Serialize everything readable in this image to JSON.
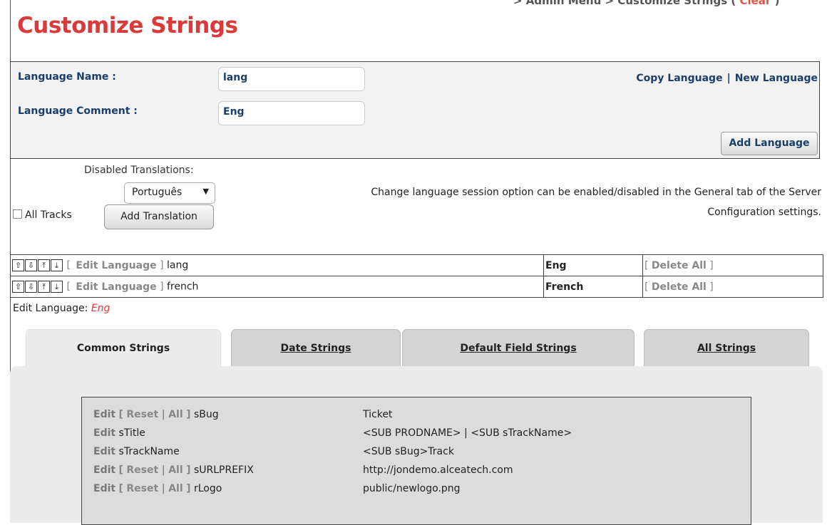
{
  "breadcrumb": {
    "admin": "> Admin Menu",
    "page": "> Customize Strings",
    "clear_open": "(",
    "clear": "Clear",
    "clear_close": ")"
  },
  "title": "Customize Strings",
  "lang_form": {
    "name_label": "Language Name :",
    "name_value": "lang",
    "comment_label": "Language Comment :",
    "comment_value": "Eng",
    "copy_language": "Copy Language",
    "link_sep": "|",
    "new_language": "New Language",
    "add_language_button": "Add Language"
  },
  "translations": {
    "disabled_label": "Disabled Translations:",
    "selected_language": "Português",
    "all_tracks_label": "All Tracks",
    "all_tracks_checked": false,
    "add_translation_button": "Add Translation",
    "notice_line1": "Change language session option can be enabled/disabled in the General tab of the Server",
    "notice_line2": "Configuration settings."
  },
  "languages": [
    {
      "edit": "Edit Language",
      "name": "lang",
      "comment": "Eng",
      "delete": "Delete All"
    },
    {
      "edit": "Edit Language",
      "name": "french",
      "comment": "French",
      "delete": "Delete All"
    }
  ],
  "edit_language": {
    "label": "Edit Language:",
    "value": "Eng"
  },
  "tabs": [
    {
      "label": "Common Strings",
      "active": true
    },
    {
      "label": "Date Strings",
      "active": false
    },
    {
      "label": "Default Field Strings",
      "active": false
    },
    {
      "label": "All Strings",
      "active": false
    }
  ],
  "strings": [
    {
      "edit": "Edit",
      "reset": "Reset",
      "all": "All",
      "has_reset": true,
      "key": "sBug",
      "value": "Ticket"
    },
    {
      "edit": "Edit",
      "reset": "",
      "all": "",
      "has_reset": false,
      "key": "sTitle",
      "value": "<SUB PRODNAME> | <SUB sTrackName>"
    },
    {
      "edit": "Edit",
      "reset": "",
      "all": "",
      "has_reset": false,
      "key": "sTrackName",
      "value": "<SUB sBug>Track"
    },
    {
      "edit": "Edit",
      "reset": "Reset",
      "all": "All",
      "has_reset": true,
      "key": "sURLPREFIX",
      "value": "http://jondemo.alceatech.com"
    },
    {
      "edit": "Edit",
      "reset": "Reset",
      "all": "All",
      "has_reset": true,
      "key": "rLogo",
      "value": "public/newlogo.png"
    }
  ],
  "icons": [
    "move-up-icon",
    "move-down-icon",
    "move-top-icon",
    "move-bottom-icon"
  ],
  "colors": {
    "title": "#d93b3b",
    "label": "#1b3f6b",
    "edit_language_value": "#e33333"
  }
}
